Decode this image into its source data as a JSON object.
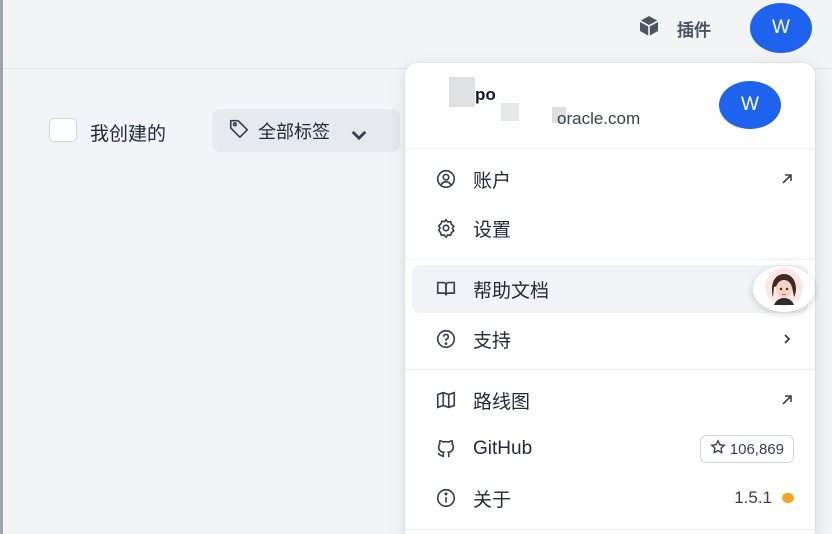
{
  "topbar": {
    "plugins_label": "插件",
    "plugins_icon": "cube-icon",
    "avatar_letter": "W",
    "accent": "#1d63ed"
  },
  "filters": {
    "mine_label": "我创建的",
    "mine_checked": false,
    "tags_label": "全部标签"
  },
  "user": {
    "name": "po",
    "email": "oracle.com",
    "avatar_letter": "W"
  },
  "menu": {
    "account": "账户",
    "settings": "设置",
    "help_docs": "帮助文档",
    "support": "支持",
    "roadmap": "路线图",
    "github": "GitHub",
    "github_stars": "106,869",
    "about": "关于",
    "version": "1.5.1",
    "update_dot_color": "#f5a524"
  }
}
